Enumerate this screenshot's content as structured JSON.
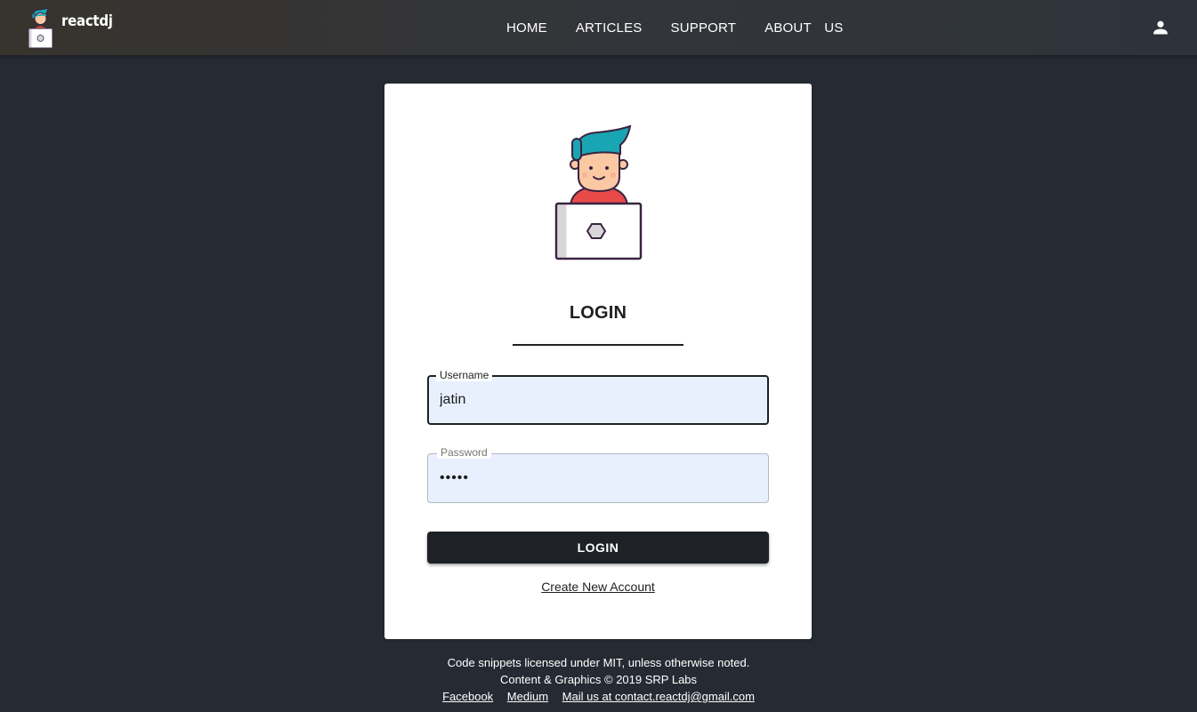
{
  "header": {
    "brand_name": "reactdj",
    "nav": [
      "HOME",
      "ARTICLES",
      "SUPPORT",
      "ABOUT  US"
    ],
    "user_icon": "account-icon"
  },
  "login": {
    "title": "LOGIN",
    "username_label": "Username",
    "username_value": "jatin",
    "password_label": "Password",
    "password_value": "•••••",
    "submit_label": "LOGIN",
    "create_account_label": "Create New Account"
  },
  "footer": {
    "line1": "Code snippets licensed under MIT, unless otherwise noted.",
    "line2": "Content & Graphics © 2019 SRP Labs",
    "links": [
      "Facebook",
      "Medium",
      "Mail us at contact.reactdj@gmail.com"
    ]
  },
  "colors": {
    "background": "#262b33",
    "card": "#ffffff",
    "input_fill": "#e8f0fe",
    "button": "#1e2126",
    "hair": "#1aa5b4",
    "shirt": "#e84a4a"
  }
}
